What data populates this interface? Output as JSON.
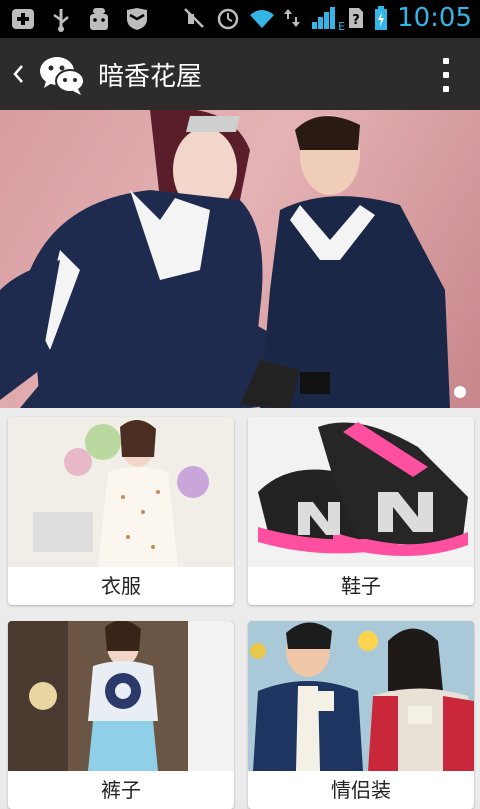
{
  "status_bar": {
    "time": "10:05",
    "network_type": "E",
    "signal_level": 1,
    "icons": [
      "add-icon",
      "usb-icon",
      "android-debug-icon",
      "shield-icon",
      "mute-icon",
      "alarm-icon",
      "wifi-icon",
      "data-arrows-icon",
      "signal-icon",
      "sim-unknown-icon",
      "battery-charging-icon"
    ]
  },
  "action_bar": {
    "title": "暗香花屋",
    "back_icon": "chevron-left-icon",
    "app_icon": "wechat-icon",
    "menu_icon": "overflow-menu-icon"
  },
  "banner": {
    "description": "couple in navy and white sports jackets",
    "page_indicator_count": 1
  },
  "categories": [
    {
      "label": "衣服"
    },
    {
      "label": "鞋子"
    },
    {
      "label": "裤子"
    },
    {
      "label": "情侣装"
    }
  ],
  "colors": {
    "status_bar": "#000000",
    "accent_blue": "#33b5e5",
    "action_bar": "#2c2c2c",
    "background": "#ececec"
  }
}
